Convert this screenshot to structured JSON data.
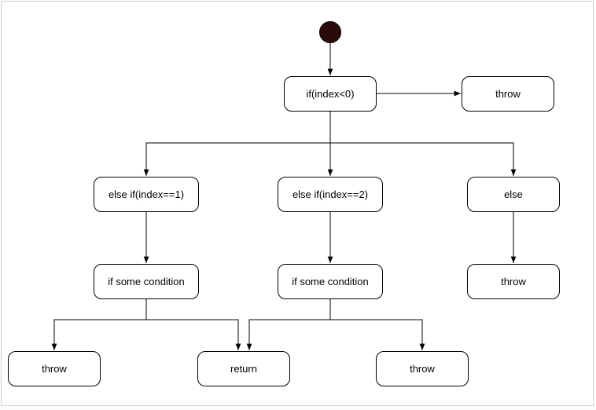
{
  "diagram": {
    "nodes": {
      "if_index_lt0": "if(index<0)",
      "throw_top": "throw",
      "elseif_1": "else if(index==1)",
      "elseif_2": "else if(index==2)",
      "else": "else",
      "if_cond_left": "if some condition",
      "if_cond_mid": "if some condition",
      "throw_right": "throw",
      "throw_bl": "throw",
      "return": "return",
      "throw_br": "throw"
    }
  }
}
